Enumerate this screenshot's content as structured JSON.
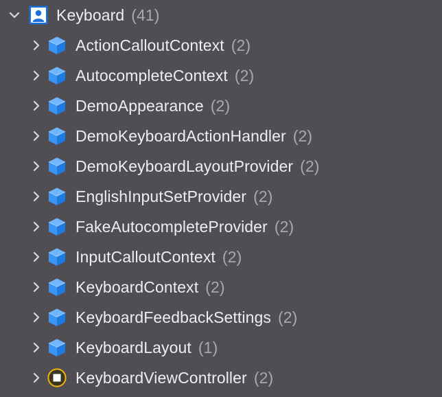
{
  "group": {
    "title": "Keyboard",
    "count": "(41)",
    "icon": "person-badge-icon",
    "expanded": true
  },
  "items": [
    {
      "name": "ActionCalloutContext",
      "count": "(2)",
      "icon": "class-cube-icon"
    },
    {
      "name": "AutocompleteContext",
      "count": "(2)",
      "icon": "class-cube-icon"
    },
    {
      "name": "DemoAppearance",
      "count": "(2)",
      "icon": "class-cube-icon"
    },
    {
      "name": "DemoKeyboardActionHandler",
      "count": "(2)",
      "icon": "class-cube-icon"
    },
    {
      "name": "DemoKeyboardLayoutProvider",
      "count": "(2)",
      "icon": "class-cube-icon"
    },
    {
      "name": "EnglishInputSetProvider",
      "count": "(2)",
      "icon": "class-cube-icon"
    },
    {
      "name": "FakeAutocompleteProvider",
      "count": "(2)",
      "icon": "class-cube-icon"
    },
    {
      "name": "InputCalloutContext",
      "count": "(2)",
      "icon": "class-cube-icon"
    },
    {
      "name": "KeyboardContext",
      "count": "(2)",
      "icon": "class-cube-icon"
    },
    {
      "name": "KeyboardFeedbackSettings",
      "count": "(2)",
      "icon": "class-cube-icon"
    },
    {
      "name": "KeyboardLayout",
      "count": "(1)",
      "icon": "class-cube-icon"
    },
    {
      "name": "KeyboardViewController",
      "count": "(2)",
      "icon": "view-controller-icon"
    }
  ],
  "colors": {
    "background": "#504e52",
    "text": "#eeeef0",
    "count_text": "#a9a8ad",
    "cube_blue": "#2f8cf0",
    "badge_blue": "#1c6fd6",
    "view_controller_yellow": "#f2b606"
  }
}
